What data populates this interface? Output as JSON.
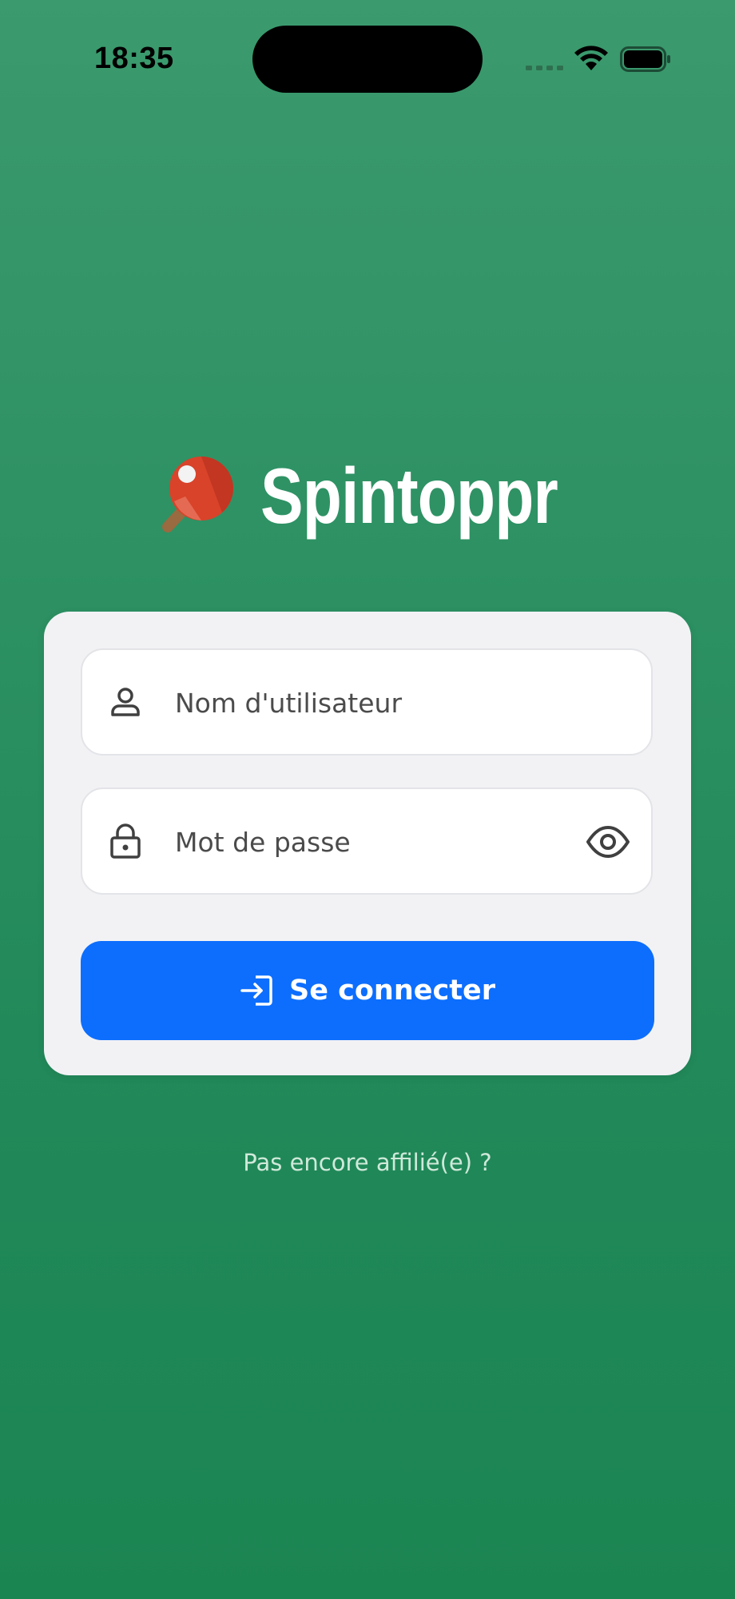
{
  "status_bar": {
    "time": "18:35",
    "icons": [
      "signal-icon",
      "wifi-icon",
      "battery-icon"
    ]
  },
  "brand": {
    "title": "Spintoppr",
    "logo_icon": "ping-pong-paddle-icon"
  },
  "form": {
    "username": {
      "placeholder": "Nom d'utilisateur",
      "value": "",
      "icon": "user-icon"
    },
    "password": {
      "placeholder": "Mot de passe",
      "value": "",
      "icon": "lock-icon",
      "toggle_icon": "eye-icon"
    },
    "submit": {
      "label": "Se connecter",
      "icon": "login-icon"
    }
  },
  "signup_link": {
    "label": "Pas encore affilié(e) ?"
  },
  "colors": {
    "background_top": "#3b9a6e",
    "background_bottom": "#1b8552",
    "card": "#f2f2f5",
    "primary_button": "#0d6efd",
    "link_text": "#cfe9da"
  }
}
